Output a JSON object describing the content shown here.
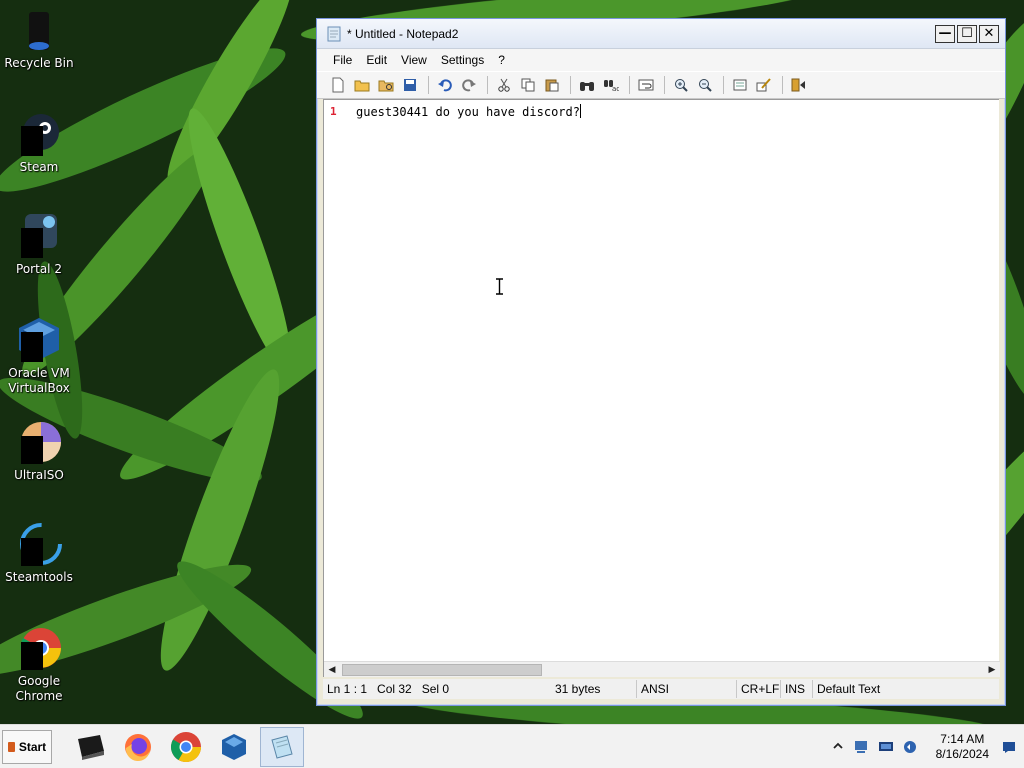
{
  "desktop": {
    "icons": [
      {
        "label": "Recycle Bin",
        "icon": "recycle-bin-icon"
      },
      {
        "label": "Steam",
        "icon": "steam-icon"
      },
      {
        "label": "Portal 2",
        "icon": "portal2-icon"
      },
      {
        "label": "Oracle VM VirtualBox",
        "icon": "virtualbox-icon"
      },
      {
        "label": "UltraISO",
        "icon": "ultraiso-icon"
      },
      {
        "label": "Steamtools",
        "icon": "steamtools-icon"
      },
      {
        "label": "Google Chrome",
        "icon": "chrome-icon"
      }
    ]
  },
  "window": {
    "title": "* Untitled - Notepad2",
    "controls": {
      "minimize": "—",
      "maximize": "☐",
      "close": "✕"
    },
    "menu": [
      "File",
      "Edit",
      "View",
      "Settings",
      "?"
    ],
    "toolbar_icons": [
      "new-file-icon",
      "open-file-icon",
      "browse-icon",
      "save-icon",
      "undo-icon",
      "redo-icon",
      "cut-icon",
      "copy-icon",
      "paste-icon",
      "find-icon",
      "replace-icon",
      "word-wrap-icon",
      "zoom-in-icon",
      "zoom-out-icon",
      "scheme-icon",
      "customize-scheme-icon",
      "exit-icon"
    ],
    "editor": {
      "line_number": "1",
      "text": "guest30441 do you have discord?"
    },
    "status": {
      "position": "Ln 1 : 1",
      "column": "Col 32",
      "selection": "Sel 0",
      "size": "31 bytes",
      "encoding": "ANSI",
      "line_endings": "CR+LF",
      "mode": "INS",
      "scheme": "Default Text"
    }
  },
  "taskbar": {
    "start_label": "Start",
    "apps": [
      "terminal-app-icon",
      "firefox-icon",
      "chrome-icon",
      "virtualbox-icon",
      "notepad2-icon"
    ],
    "clock": {
      "time": "7:14 AM",
      "date": "8/16/2024"
    }
  },
  "colors": {
    "line_number": "#dd2233",
    "titlebar": "#e9eef7",
    "taskbar": "#f2f2f2"
  }
}
